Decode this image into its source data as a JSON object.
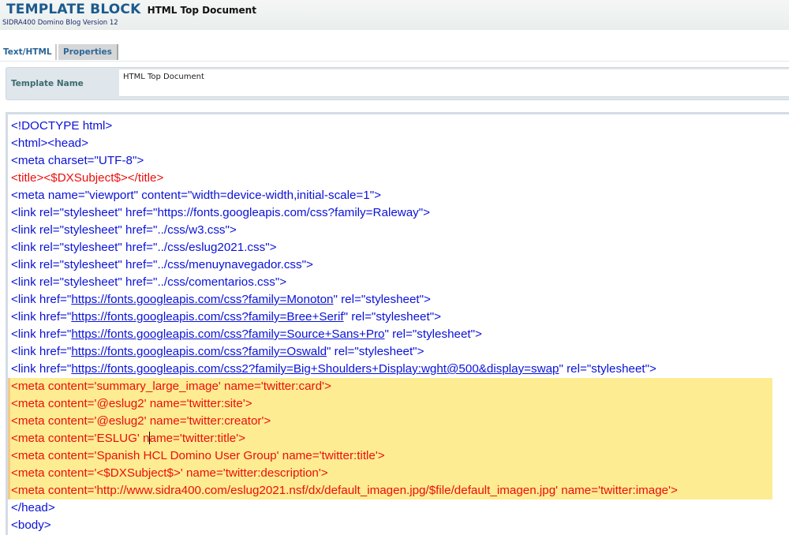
{
  "header": {
    "brand": "TEMPLATE BLOCK",
    "document_title": "HTML Top Document",
    "subtitle": "SIDRA400 Domino Blog Version 12"
  },
  "tabs": [
    {
      "label": "Text/HTML",
      "active": true
    },
    {
      "label": "Properties",
      "active": false
    }
  ],
  "template_name": {
    "label": "Template Name",
    "value": "HTML Top Document"
  },
  "editor": {
    "colors": {
      "tag": "#0a12d8",
      "highlight_text": "#ee0d0d",
      "highlight_bg": "#fdec91"
    },
    "lines": [
      {
        "text": "<!DOCTYPE html>"
      },
      {
        "text": "<html><head>"
      },
      {
        "text": "<meta charset=\"UTF-8\">"
      },
      {
        "text": "<title><$DXSubject$></title>",
        "red": true
      },
      {
        "text": "<meta name=\"viewport\" content=\"width=device-width,initial-scale=1\">"
      },
      {
        "text": "<link rel=\"stylesheet\" href=\"https://fonts.googleapis.com/css?family=Raleway\">"
      },
      {
        "text": "<link rel=\"stylesheet\" href=\"../css/w3.css\">"
      },
      {
        "text": "<link rel=\"stylesheet\" href=\"../css/eslug2021.css\">"
      },
      {
        "text": "<link rel=\"stylesheet\" href=\"../css/menuynavegador.css\">"
      },
      {
        "text": "<link rel=\"stylesheet\" href=\"../css/comentarios.css\">"
      },
      {
        "pre": "<link href=\"",
        "url": "https://fonts.googleapis.com/css?family=Monoton",
        "post": "\" rel=\"stylesheet\">"
      },
      {
        "pre": "<link href=\"",
        "url": "https://fonts.googleapis.com/css?family=Bree+Serif",
        "post": "\" rel=\"stylesheet\">"
      },
      {
        "pre": "<link href=\"",
        "url": "https://fonts.googleapis.com/css?family=Source+Sans+Pro",
        "post": "\" rel=\"stylesheet\">"
      },
      {
        "pre": "<link href=\"",
        "url": "https://fonts.googleapis.com/css?family=Oswald",
        "post": "\" rel=\"stylesheet\">"
      },
      {
        "pre": "<link href=\"",
        "url": "https://fonts.googleapis.com/css2?family=Big+Shoulders+Display:wght@500&display=swap",
        "post": "\" rel=\"stylesheet\">"
      },
      {
        "text": "<meta content='summary_large_image' name='twitter:card'>",
        "red": true
      },
      {
        "text": "<meta content='@eslug2' name='twitter:site'>",
        "red": true
      },
      {
        "text": "<meta content='@eslug2' name='twitter:creator'>",
        "red": true
      },
      {
        "pre": "<meta content='ESLUG' n",
        "caret": true,
        "post": "ame='twitter:title'>",
        "red": true
      },
      {
        "text": "<meta content='Spanish HCL Domino User Group' name='twitter:title'>",
        "red": true
      },
      {
        "text": "<meta content='<$DXSubject$>' name='twitter:description'>",
        "red": true
      },
      {
        "text": "<meta content='http://www.sidra400.com/eslug2021.nsf/dx/default_imagen.jpg/$file/default_imagen.jpg' name='twitter:image'>",
        "red": true
      },
      {
        "text": "</head>"
      },
      {
        "text": "<body>"
      }
    ]
  }
}
